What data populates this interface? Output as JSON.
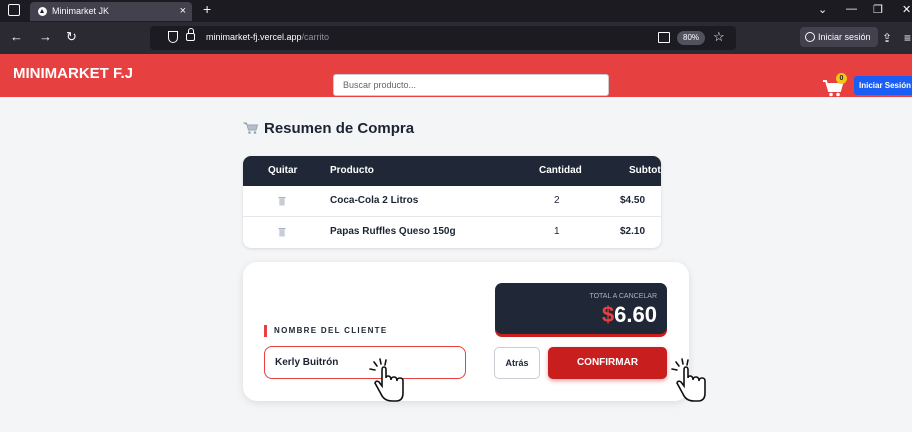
{
  "browser": {
    "tab_title": "Minimarket JK",
    "url_domain": "minimarket-fj.vercel.app",
    "url_path": "/carrito",
    "zoom": "80%",
    "signin_label": "Iniciar sesión"
  },
  "header": {
    "brand": "MINIMARKET F.J",
    "search_placeholder": "Buscar producto...",
    "cart_count": "0",
    "login_label": "Iniciar Sesión",
    "color": "#e74040"
  },
  "summary": {
    "title": "Resumen de Compra",
    "columns": [
      "Quitar",
      "Producto",
      "Cantidad",
      "Subtotal"
    ],
    "rows": [
      {
        "product": "Coca-Cola 2 Litros",
        "quantity": "2",
        "subtotal": "$4.50"
      },
      {
        "product": "Papas Ruffles Queso 150g",
        "quantity": "1",
        "subtotal": "$2.10"
      }
    ]
  },
  "checkout": {
    "total_label": "TOTAL A CANCELAR",
    "currency": "$",
    "total_amount": "6.60",
    "client_label": "NOMBRE DEL CLIENTE",
    "client_value": "Kerly Buitrón",
    "back_label": "Atrás",
    "confirm_label": "CONFIRMAR"
  },
  "colors": {
    "accent": "#e74040",
    "dark": "#202838",
    "confirm": "#c81e1e",
    "login": "#1a5ef5"
  },
  "icons": [
    "tab-overview-icon",
    "firefox-favicon",
    "back-arrow-icon",
    "forward-arrow-icon",
    "reload-icon",
    "shield-icon",
    "lock-icon",
    "reader-view-icon",
    "bookmark-star-icon",
    "account-icon",
    "share-icon",
    "menu-icon",
    "cart-icon",
    "trash-icon",
    "click-hand-icon"
  ]
}
